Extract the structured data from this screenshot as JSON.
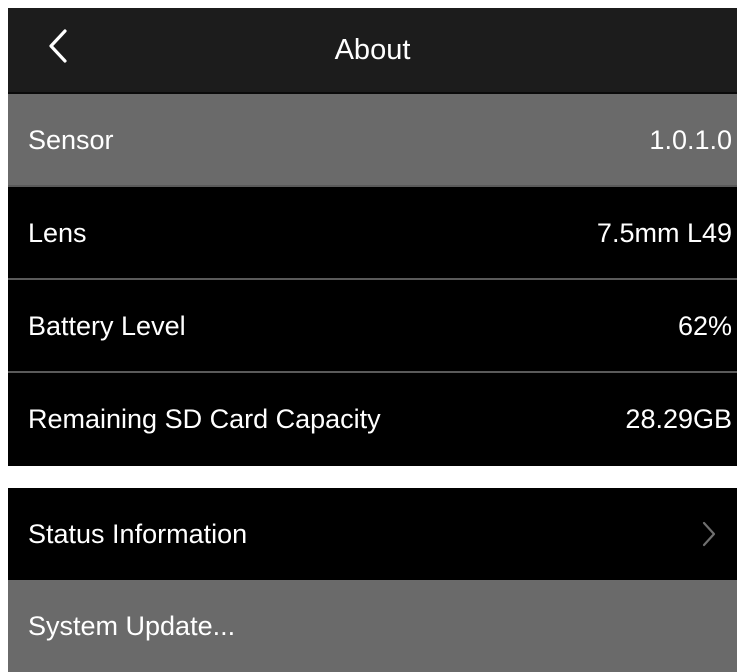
{
  "header": {
    "title": "About",
    "back_icon": "chevron-left-icon"
  },
  "info_rows": [
    {
      "label": "Sensor",
      "value": "1.0.1.0"
    },
    {
      "label": "Lens",
      "value": "7.5mm L49"
    },
    {
      "label": "Battery Level",
      "value": "62%"
    },
    {
      "label": "Remaining SD Card Capacity",
      "value": "28.29GB"
    }
  ],
  "action_rows": [
    {
      "label": "Status Information",
      "icon": "chevron-right-icon"
    },
    {
      "label": "System Update..."
    }
  ],
  "colors": {
    "header_bg": "#1c1c1c",
    "row_bg": "#000000",
    "highlight_bg": "#6a6a6a",
    "separator": "#5a5a5a",
    "text": "#ffffff",
    "chevron_muted": "#6f6f6f"
  }
}
